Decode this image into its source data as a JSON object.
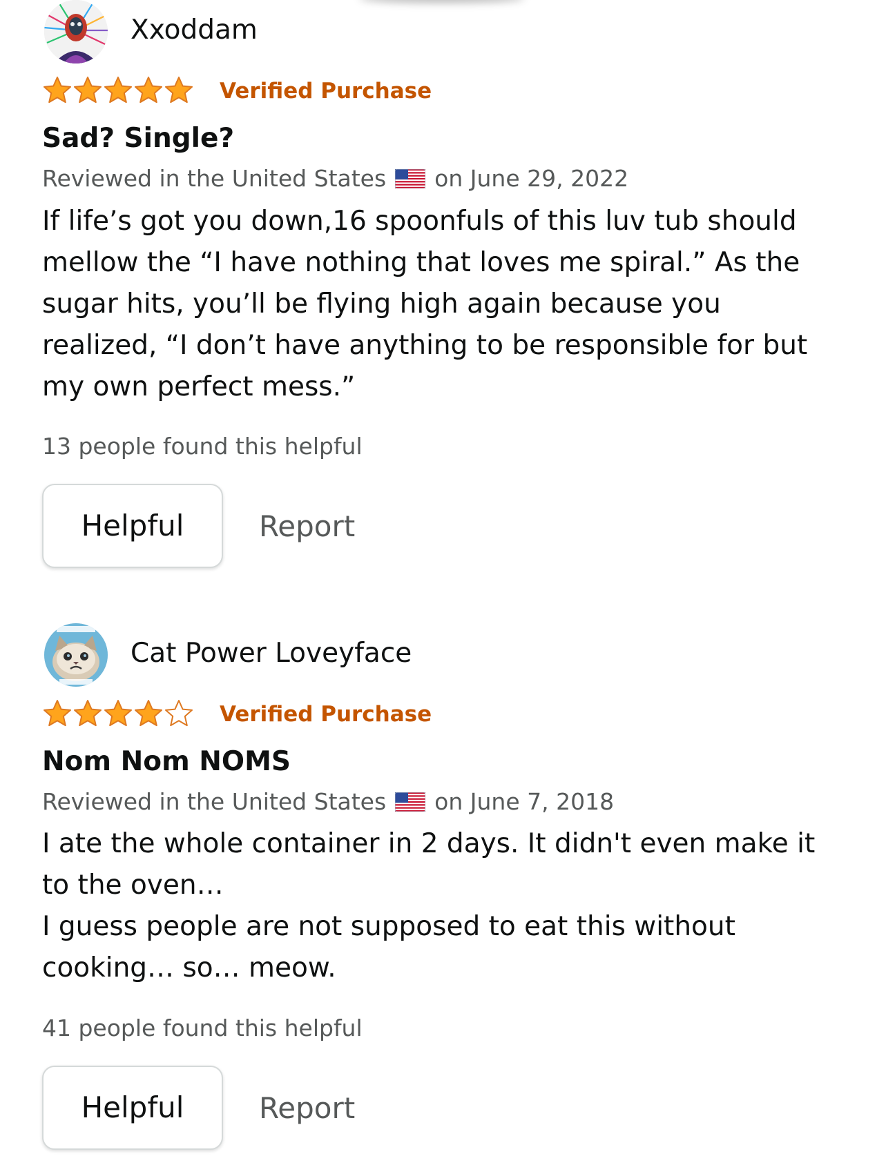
{
  "colors": {
    "star_fill": "#ffa41c",
    "star_stroke": "#de7921",
    "verified": "#c45500",
    "text_primary": "#0f1111",
    "text_secondary": "#565959",
    "button_border": "#d5d9d9"
  },
  "reviews": [
    {
      "reviewer_name": "Xxoddam",
      "avatar_icon": "psychedelic-portrait-avatar",
      "rating": 5,
      "rating_max": 5,
      "verified_label": "Verified Purchase",
      "title": "Sad? Single?",
      "meta_prefix": "Reviewed in the United States",
      "flag_icon": "us-flag-icon",
      "meta_date": "on June 29, 2022",
      "body_lines": [
        "If life’s got you down,16 spoonfuls of this luv tub should",
        "mellow the “I have nothing that loves me spiral.” As the",
        "sugar hits, you’ll be flying high again because you",
        "realized, “I don’t have anything to be responsible for but",
        "my own perfect mess.”"
      ],
      "helpful_count_text": "13 people found this helpful",
      "helpful_button_label": "Helpful",
      "report_label": "Report"
    },
    {
      "reviewer_name": "Cat Power Loveyface",
      "avatar_icon": "grumpy-cat-avatar",
      "rating": 4,
      "rating_max": 5,
      "verified_label": "Verified Purchase",
      "title": "Nom Nom NOMS",
      "meta_prefix": "Reviewed in the United States",
      "flag_icon": "us-flag-icon",
      "meta_date": "on June 7, 2018",
      "body_lines": [
        "I ate the whole container in 2 days. It didn't even make it",
        "to the oven…",
        "I guess people are not supposed to eat this without",
        "cooking… so… meow."
      ],
      "helpful_count_text": "41 people found this helpful",
      "helpful_button_label": "Helpful",
      "report_label": "Report"
    }
  ]
}
